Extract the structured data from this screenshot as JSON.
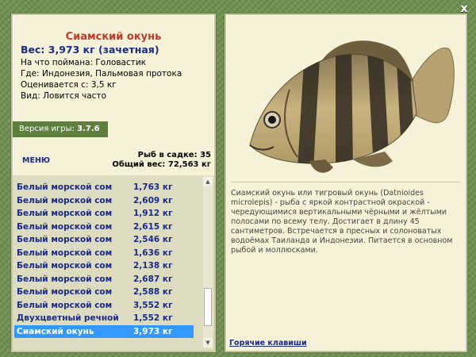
{
  "close_label": "x",
  "fish": {
    "title": "Сиамский окунь",
    "weight": "Вес: 3,973 кг (зачетная)",
    "bait": "На что поймана: Головастик",
    "location": "Где: Индонезия, Пальмовая протока",
    "rated": "Оценивается с: 3,5 кг",
    "kind": "Вид: Ловится часто"
  },
  "version": {
    "label": "Версия игры:",
    "value": "3.7.6"
  },
  "menu_label": "МЕНЮ",
  "stats": {
    "in_cage": "Рыб в садке: 35",
    "total": "Общий вес: 72,563 кг"
  },
  "catch_list": [
    {
      "name": "Белый морской сом",
      "weight": "1,763 кг"
    },
    {
      "name": "Белый морской сом",
      "weight": "2,609 кг"
    },
    {
      "name": "Белый морской сом",
      "weight": "1,912 кг"
    },
    {
      "name": "Белый морской сом",
      "weight": "2,615 кг"
    },
    {
      "name": "Белый морской сом",
      "weight": "2,546 кг"
    },
    {
      "name": "Белый морской сом",
      "weight": "1,636 кг"
    },
    {
      "name": "Белый морской сом",
      "weight": "2,138 кг"
    },
    {
      "name": "Белый морской сом",
      "weight": "2,687 кг"
    },
    {
      "name": "Белый морской сом",
      "weight": "2,588 кг"
    },
    {
      "name": "Белый морской сом",
      "weight": "3,552 кг"
    },
    {
      "name": "Двухцветный речной у...",
      "weight": "1,552 кг"
    },
    {
      "name": "Сиамский окунь",
      "weight": "3,973 кг"
    }
  ],
  "description": "Сиамский окунь или тигровый окунь (Datnioides microlepis) - рыба с яркой контрастной окраской - чередующимися вертикальными чёрными и жёлтыми полосами по всему телу. Достигает в длину 45 сантиметров. Встречается в пресных и солоноватых водоёмах Таиланда и Индонезии. Питается в основном рыбой и моллюсками.",
  "hotkeys_label": "Горячие клавиши"
}
